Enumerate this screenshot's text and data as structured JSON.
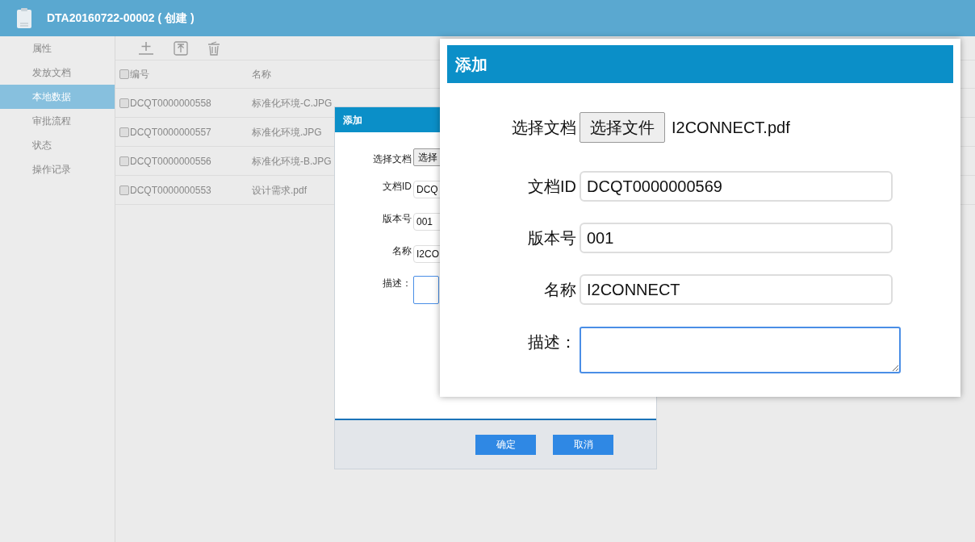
{
  "header": {
    "title": "DTA20160722-00002 ( 创建 )"
  },
  "sidebar": {
    "items": [
      {
        "label": "属性",
        "selected": false
      },
      {
        "label": "发放文档",
        "selected": false
      },
      {
        "label": "本地数据",
        "selected": true
      },
      {
        "label": "审批流程",
        "selected": false
      },
      {
        "label": "状态",
        "selected": false
      },
      {
        "label": "操作记录",
        "selected": false
      }
    ]
  },
  "table": {
    "header_checked": false,
    "columns": [
      "编号",
      "名称"
    ],
    "rows": [
      {
        "checked": false,
        "cells": [
          "DCQT0000000558",
          "标准化环境-C.JPG"
        ]
      },
      {
        "checked": false,
        "cells": [
          "DCQT0000000557",
          "标准化环境.JPG"
        ]
      },
      {
        "checked": false,
        "cells": [
          "DCQT0000000556",
          "标准化环境-B.JPG"
        ]
      },
      {
        "checked": false,
        "cells": [
          "DCQT0000000553",
          "设计需求.pdf"
        ]
      }
    ]
  },
  "dialog": {
    "title": "添加",
    "fields": [
      {
        "kind": "file",
        "label": "选择文档",
        "button": "选择"
      },
      {
        "kind": "text",
        "label": "文档ID",
        "value": "DCQ"
      },
      {
        "kind": "text",
        "label": "版本号",
        "value": "001"
      },
      {
        "kind": "text",
        "label": "名称",
        "value": "I2CO"
      },
      {
        "kind": "textarea",
        "label": "描述："
      }
    ],
    "buttons": [
      "确定",
      "取消"
    ]
  },
  "zoomed_dialog": {
    "title": "添加",
    "fields": [
      {
        "kind": "file",
        "label": "选择文档",
        "button": "选择文件",
        "file_name": "I2CONNECT.pdf"
      },
      {
        "kind": "text",
        "label": "文档ID",
        "value": "DCQT0000000569"
      },
      {
        "kind": "text",
        "label": "版本号",
        "value": "001"
      },
      {
        "kind": "text",
        "label": "名称",
        "value": "I2CONNECT"
      },
      {
        "kind": "textarea",
        "label": "描述："
      }
    ]
  }
}
